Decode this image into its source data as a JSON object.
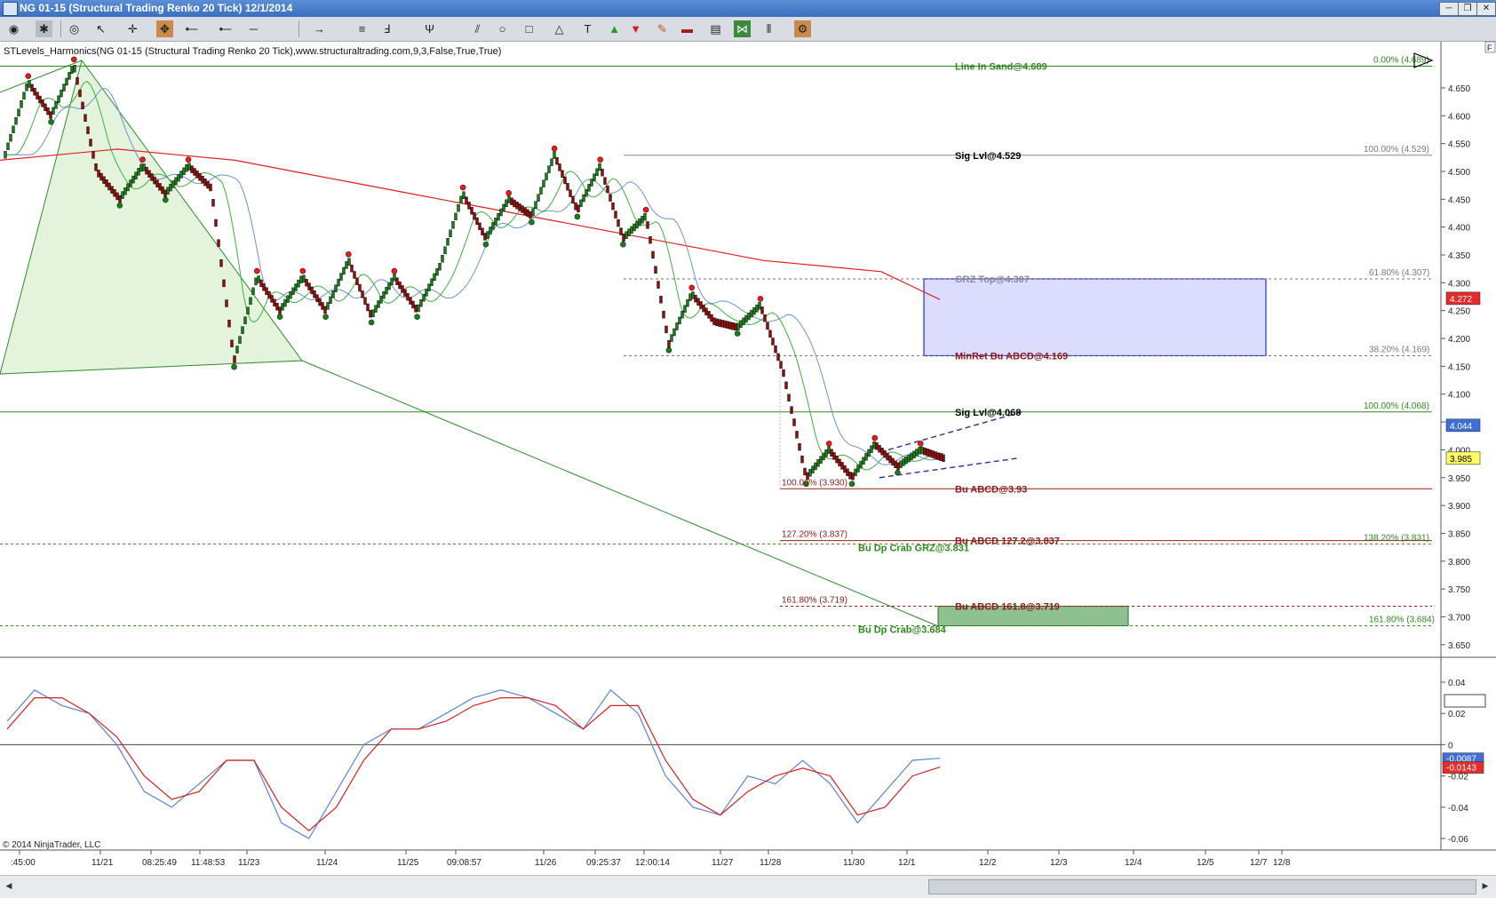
{
  "window": {
    "title": "NG 01-15 (Structural Trading Renko 20 Tick)  12/1/2014",
    "min_label": "─",
    "restore_label": "❐",
    "close_label": "✕"
  },
  "toolbar": {
    "icons": [
      "eye-icon",
      "settings-icon",
      "eye-icon",
      "cursor-icon",
      "crosshair-icon",
      "pan-icon",
      "line-icon",
      "ray-icon",
      "horizontal-line-icon",
      "arrow-line-icon",
      "lines-icon",
      "fibonacci-icon",
      "pitchfork-icon",
      "channel-icon",
      "ellipse-icon",
      "rectangle-icon",
      "triangle-icon",
      "text-icon",
      "arrow-up-icon",
      "arrow-down-icon",
      "pencil-icon",
      "panel-icon",
      "data-box-icon",
      "chart-type-icon",
      "bar-type-icon",
      "properties-icon"
    ]
  },
  "chart": {
    "indicator_label": "STLevels_Harmonics(NG 01-15 (Structural Trading Renko 20 Tick),www.structuraltrading.com,9,3,False,True,True)",
    "copyright": "© 2014 NinjaTrader, LLC",
    "f_button": "F",
    "price_labels": [
      {
        "text": "Line In Sand@4.689",
        "color": "#2e8b1e",
        "price": 4.689
      },
      {
        "text": "Sig Lvl@4.529",
        "color": "#000000",
        "price": 4.529
      },
      {
        "text": "GRZ Top@4.307",
        "color": "#8a8a9a",
        "price": 4.307
      },
      {
        "text": "MinRet Bu ABCD@4.169",
        "color": "#8b1a1a",
        "price": 4.169
      },
      {
        "text": "Sig Lvl@4.068",
        "color": "#000000",
        "price": 4.068
      },
      {
        "text": "Bu ABCD@3.93",
        "color": "#8b1a1a",
        "price": 3.93
      },
      {
        "text": "Bu ABCD 127.2@3.837",
        "color": "#8b1a1a",
        "price": 3.837
      },
      {
        "text": "Bu Dp Crab GRZ@3.831",
        "color": "#2e8b1e",
        "price": 3.831
      },
      {
        "text": "Bu ABCD 161.8@3.719",
        "color": "#8b1a1a",
        "price": 3.719
      },
      {
        "text": "Bu Dp Crab@3.684",
        "color": "#2e8b1e",
        "price": 3.684
      }
    ],
    "fib_labels": [
      {
        "text": "0.00% (4.689)",
        "color": "#2e8b1e",
        "price": 4.689
      },
      {
        "text": "100.00% (4.529)",
        "color": "#7a7a7a",
        "price": 4.529
      },
      {
        "text": "61.80% (4.307)",
        "color": "#7a7a7a",
        "price": 4.307
      },
      {
        "text": "38.20% (4.169)",
        "color": "#7a7a7a",
        "price": 4.169
      },
      {
        "text": "100.00% (4.068)",
        "color": "#2e8b1e",
        "price": 4.068
      },
      {
        "text": "100.00% (3.930)",
        "color": "#8b1a1a",
        "price": 3.93
      },
      {
        "text": "127.20% (3.837)",
        "color": "#8b1a1a",
        "price": 3.837
      },
      {
        "text": "138.20% (3.831)",
        "color": "#2e8b1e",
        "price": 3.831
      },
      {
        "text": "161.80% (3.719)",
        "color": "#8b1a1a",
        "price": 3.719
      },
      {
        "text": "161.80% (3.684)",
        "color": "#2e8b1e",
        "price": 3.684
      }
    ],
    "price_tags": [
      {
        "text": "4.272",
        "bg": "#e52b2b",
        "fg": "#ffffff",
        "price": 4.272
      },
      {
        "text": "4.044",
        "bg": "#3e6fd8",
        "fg": "#ffffff",
        "price": 4.044
      },
      {
        "text": "3.985",
        "bg": "#ffff66",
        "fg": "#000000",
        "price": 3.985
      }
    ],
    "osc_tags": [
      {
        "text": "-0.0087",
        "bg": "#3e6fd8",
        "fg": "#ffffff",
        "value": -0.0087
      },
      {
        "text": "-0.0143",
        "bg": "#e52b2b",
        "fg": "#ffffff",
        "value": -0.0143
      }
    ]
  },
  "chart_data": {
    "type": "line",
    "title": "NG 01-15 (Structural Trading Renko 20 Tick)  12/1/2014",
    "price_axis": {
      "ylim": [
        3.63,
        4.71
      ],
      "ticks": [
        "4.650",
        "4.600",
        "4.550",
        "4.500",
        "4.450",
        "4.400",
        "4.350",
        "4.300",
        "4.250",
        "4.200",
        "4.150",
        "4.100",
        "4.050",
        "4.000",
        "3.950",
        "3.900",
        "3.850",
        "3.800",
        "3.750",
        "3.700",
        "3.650"
      ]
    },
    "oscillator_axis": {
      "ylim": [
        -0.065,
        0.045
      ],
      "ticks": [
        "0.04",
        "0.02",
        "0",
        "-0.02",
        "-0.04",
        "-0.06"
      ]
    },
    "x_tick_labels": [
      ":45:00",
      "11/21",
      "08:25:49",
      "11:48:53",
      "11/23",
      "11/24",
      "11/25",
      "09:08:57",
      "11/26",
      "09:25:37",
      "12:00:14",
      "11/27",
      "11/28",
      "11/30",
      "12/1",
      "12/2",
      "12/3",
      "12/4",
      "12/5",
      "12/7",
      "12/8"
    ],
    "renko_path": [
      4.53,
      4.66,
      4.6,
      4.69,
      4.5,
      4.45,
      4.51,
      4.46,
      4.51,
      4.47,
      4.16,
      4.31,
      4.25,
      4.31,
      4.25,
      4.34,
      4.24,
      4.31,
      4.25,
      4.33,
      4.46,
      4.38,
      4.45,
      4.42,
      4.53,
      4.43,
      4.51,
      4.38,
      4.42,
      4.19,
      4.28,
      4.23,
      4.22,
      4.26,
      4.14,
      3.95,
      4.0,
      3.95,
      4.01,
      3.97,
      4.0,
      3.985
    ],
    "moving_average_slow_red": [
      4.52,
      4.53,
      4.54,
      4.53,
      4.52,
      4.5,
      4.48,
      4.46,
      4.44,
      4.42,
      4.4,
      4.38,
      4.36,
      4.34,
      4.33,
      4.32,
      4.27
    ],
    "harmonic_points": {
      "X": 4.53,
      "A": 4.689,
      "B": 4.16,
      "D": 3.684
    },
    "bull_channel": {
      "upper": [
        4.0,
        4.068
      ],
      "lower": [
        3.95,
        3.985
      ]
    },
    "zones": [
      {
        "name": "GRZ",
        "top": 4.307,
        "bottom": 4.169,
        "color": "#dcdcff"
      },
      {
        "name": "Bu Dp Crab",
        "top": 3.719,
        "bottom": 3.684,
        "color": "#8fc08f"
      }
    ],
    "oscillator": {
      "blue": [
        0.015,
        0.035,
        0.025,
        0.02,
        0.0,
        -0.03,
        -0.04,
        -0.025,
        -0.01,
        -0.01,
        -0.05,
        -0.06,
        -0.03,
        0.0,
        0.01,
        0.01,
        0.02,
        0.03,
        0.035,
        0.03,
        0.02,
        0.01,
        0.035,
        0.02,
        -0.02,
        -0.04,
        -0.045,
        -0.02,
        -0.025,
        -0.01,
        -0.025,
        -0.05,
        -0.03,
        -0.01,
        -0.0087
      ],
      "red": [
        0.01,
        0.03,
        0.03,
        0.02,
        0.005,
        -0.02,
        -0.035,
        -0.03,
        -0.01,
        -0.01,
        -0.04,
        -0.055,
        -0.04,
        -0.01,
        0.01,
        0.01,
        0.015,
        0.025,
        0.03,
        0.03,
        0.025,
        0.01,
        0.025,
        0.025,
        -0.01,
        -0.035,
        -0.045,
        -0.03,
        -0.02,
        -0.015,
        -0.02,
        -0.045,
        -0.04,
        -0.02,
        -0.0143
      ]
    }
  }
}
